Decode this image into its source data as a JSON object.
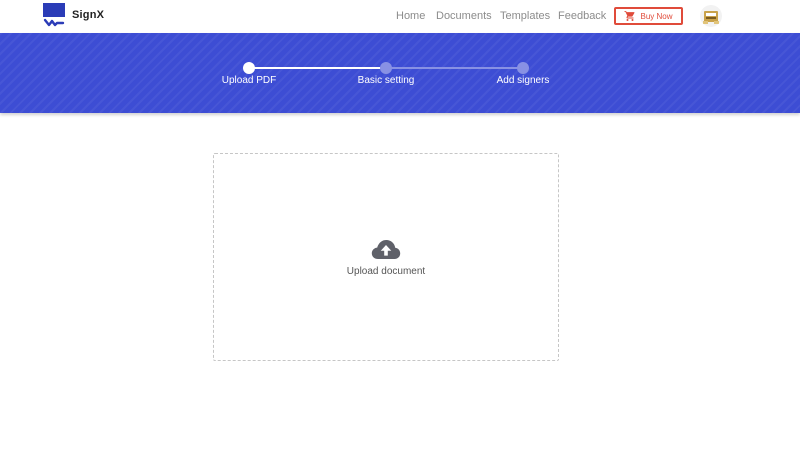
{
  "brand": {
    "name": "SignX",
    "color": "#2b3cb7"
  },
  "nav": {
    "home": "Home",
    "documents": "Documents",
    "templates": "Templates",
    "feedback": "Feedback"
  },
  "buy_button": {
    "label": "Buy Now",
    "icon": "cart-icon",
    "color": "#e04b3a"
  },
  "account": {
    "icon": "user-avatar"
  },
  "stepper": {
    "steps": [
      {
        "label": "Upload PDF",
        "state": "active"
      },
      {
        "label": "Basic setting",
        "state": "pending"
      },
      {
        "label": "Add signers",
        "state": "pending"
      }
    ],
    "accent": "#3d4dd4"
  },
  "upload": {
    "label": "Upload document",
    "icon": "cloud-upload-icon"
  }
}
